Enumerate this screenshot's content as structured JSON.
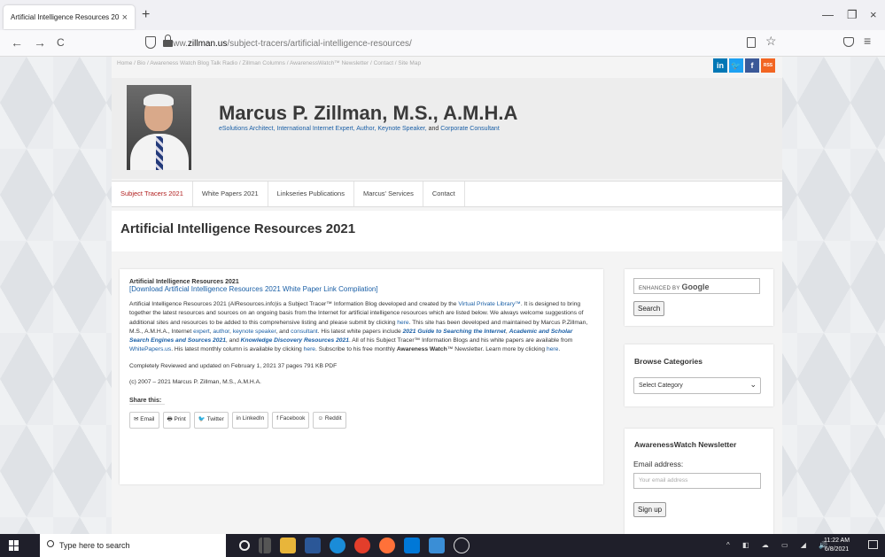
{
  "browser": {
    "tab_title": "Artificial Intelligence Resources 202",
    "tab_close": "×",
    "new_tab": "+",
    "url_prefix": "www.",
    "url_domain": "zillman.us",
    "url_path": "/subject-tracers/artificial-intelligence-resources/",
    "back": "←",
    "forward": "→",
    "reload": "C",
    "minimize": "—",
    "restore": "❐",
    "close": "×",
    "star": "☆",
    "menu": "≡"
  },
  "site": {
    "topnav": "Home  /  Bio  /  Awareness Watch Blog Talk Radio  /  Zillman Columns  /  AwarenessWatch™ Newsletter  /  Contact  /  Site Map",
    "social": [
      "in",
      "🐦",
      "f",
      "RSS"
    ],
    "name": "Marcus P. Zillman, M.S., A.M.H.A",
    "tagline_part1": "eSolutions Architect, International Internet Expert, Author, Keynote Speaker,",
    "tagline_and": " and ",
    "tagline_part2": "Corporate Consultant",
    "nav": [
      "Subject Tracers 2021",
      "White Papers 2021",
      "Linkseries Publications",
      "Marcus' Services",
      "Contact"
    ],
    "page_title": "Artificial Intelligence Resources 2021"
  },
  "content": {
    "title": "Artificial Intelligence Resources 2021",
    "download_link": "[Download Artificial Intelligence Resources 2021 White Paper Link Compilation]",
    "p1_a": "Artificial Intelligence Resources 2021 (AIResources.info)is a Subject Tracer™ Information Blog developed and created by the ",
    "p1_link1": "Virtual Private Library™",
    "p1_b": ". It is designed to bring together the latest resources and sources on an ongoing basis from the Internet for artificial intelligence resources which are listed below. We always welcome suggestions of additional sites and resources to be added to this comprehensive listing and please submit by clicking ",
    "here1": "here",
    "p1_c": ". This site has been developed and maintained by Marcus P.Zillman, M.S., A.M.H.A., Internet ",
    "expert": "expert",
    "author": "author",
    "keynote": "keynote speaker",
    "consultant": "consultant",
    "p1_d": ". His latest white papers include ",
    "wp1": "2021 Guide to Searching the Internet",
    "wp2": "Academic and Scholar Search Engines and Sources 2021",
    "wp3": "Knowledge Discovery Resources 2021",
    "p1_e": ". All of his Subject Tracer™ Information Blogs and his white papers are available from ",
    "whitepapers": "WhitePapers.us",
    "p1_f": ". His latest monthly column is available by clicking ",
    "here2": "here",
    "p1_g": ". Subscribe to his free monthly ",
    "aw": "Awareness Watch",
    "p1_h": "™ Newsletter. Learn more by clicking ",
    "here3": "here",
    "reviewed": "Completely Reviewed and updated on February 1, 2021 37 pages 791 KB PDF",
    "copyright": "(c) 2007 – 2021 Marcus P. Zillman, M.S., A.M.H.A.",
    "share_title": "Share this:",
    "share_buttons": [
      "✉ Email",
      "🖶 Print",
      "🐦 Twitter",
      "in LinkedIn",
      "f Facebook",
      "☺ Reddit"
    ]
  },
  "sidebar": {
    "google_label": "ENHANCED BY ",
    "google_brand": "Google",
    "search_button": "Search",
    "browse_title": "Browse Categories",
    "select_value": "Select Category",
    "newsletter_title": "AwarenessWatch Newsletter",
    "email_label": "Email address:",
    "email_placeholder": "Your email address",
    "signup": "Sign up"
  },
  "taskbar": {
    "search_placeholder": "Type here to search",
    "time": "11:22 AM",
    "date": "6/8/2021"
  },
  "colors": {
    "link": "#1a5fa6",
    "active_nav": "#b11e1e",
    "linkedin": "#0077b5",
    "twitter": "#1da1f2",
    "facebook": "#3b5998",
    "rss": "#f26522"
  }
}
